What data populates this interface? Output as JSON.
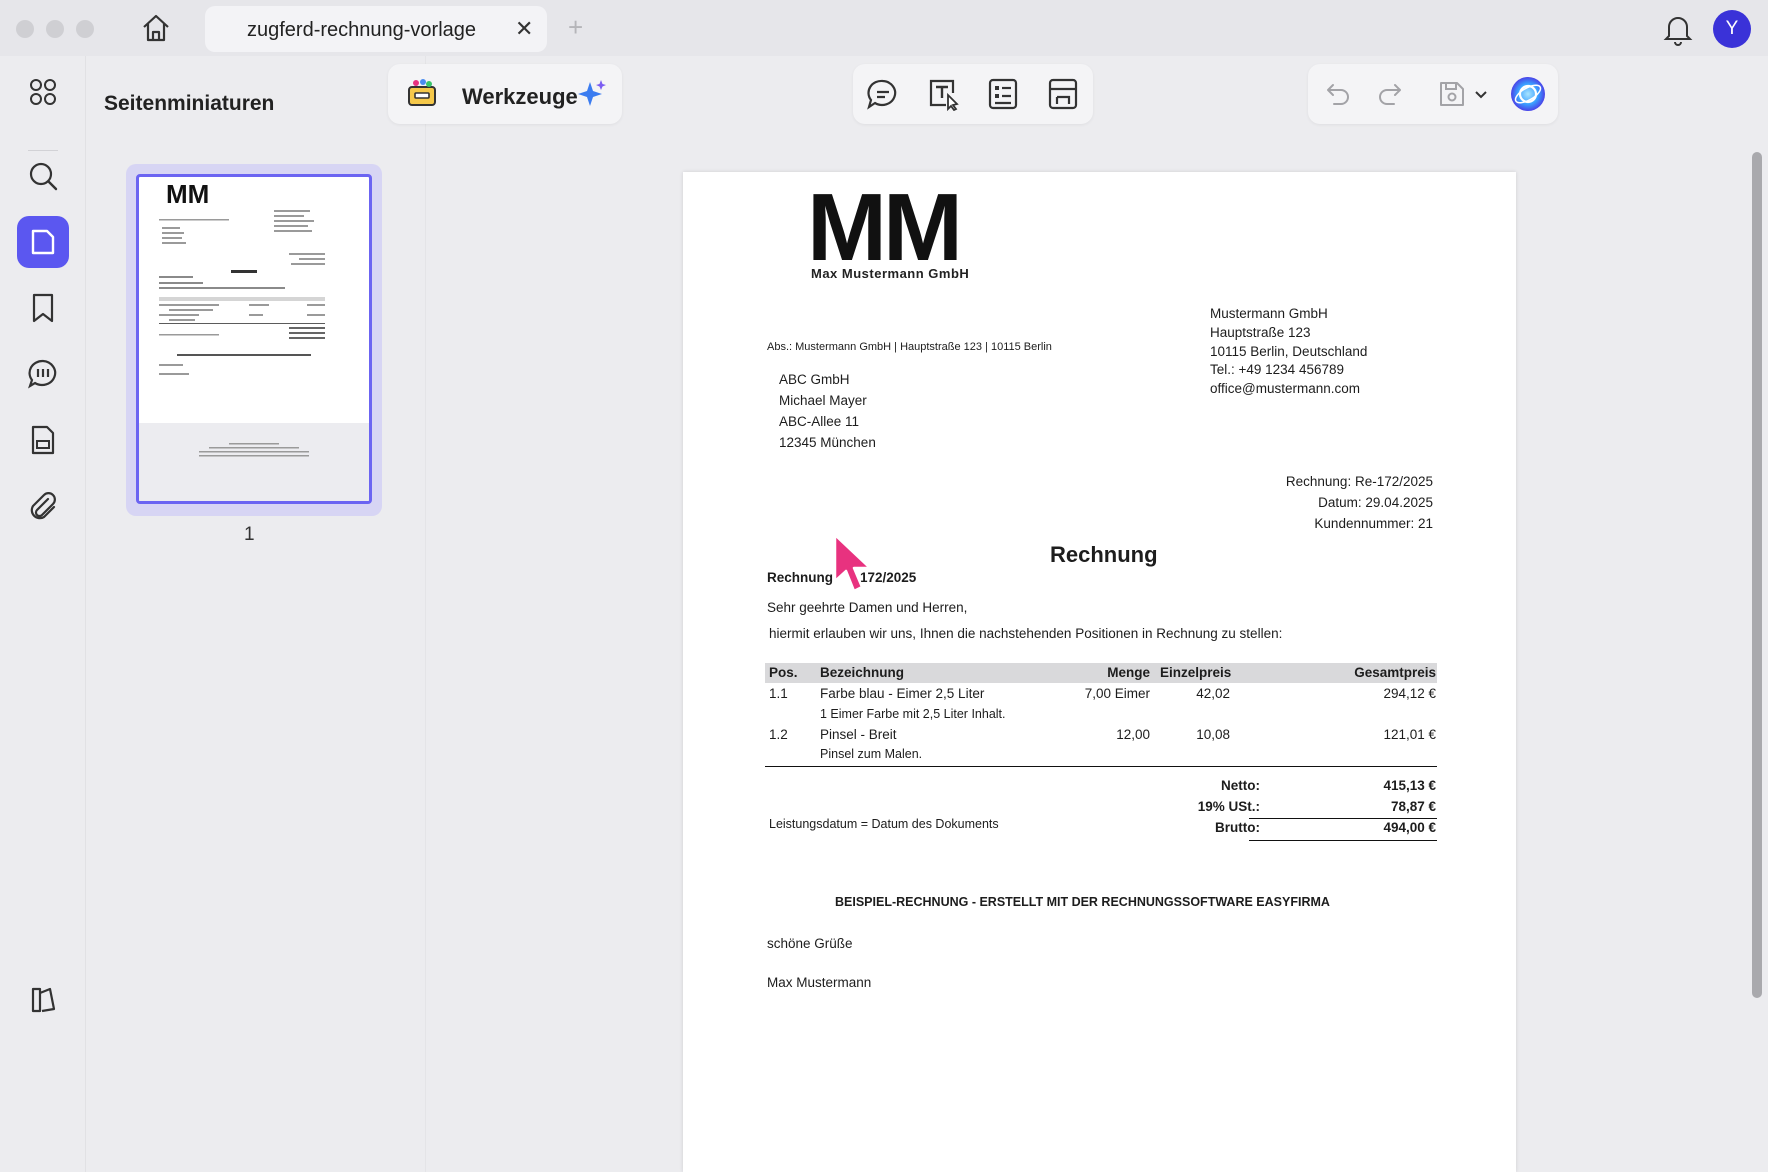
{
  "window": {
    "tab_title": "zugferd-rechnung-vorlage",
    "tab_close": "✕",
    "tab_add": "+",
    "avatar_initial": "Y"
  },
  "sidebar": {
    "panel_title": "Seitenminiaturen",
    "page_number": "1",
    "rail_items": [
      "grid-icon",
      "search-icon",
      "pages-icon",
      "bookmark-icon",
      "comments-icon",
      "forms-icon",
      "attachment-icon",
      "sidebar-toggle-icon"
    ]
  },
  "toolbar": {
    "tools_label": "Werkzeuge",
    "center_icons": [
      "comment-icon",
      "text-edit-icon",
      "form-list-icon",
      "crop-layout-icon"
    ],
    "right_icons": [
      "undo-icon",
      "redo-icon",
      "save-icon",
      "chevron-down-icon",
      "ai-assistant-icon"
    ]
  },
  "document": {
    "logo": {
      "mark": "MM",
      "company": "Max Mustermann GmbH"
    },
    "sender_line": "Abs.: Mustermann GmbH | Hauptstraße 123 | 10115 Berlin",
    "sender_address": [
      "Mustermann GmbH",
      "Hauptstraße 123",
      "10115 Berlin, Deutschland",
      "Tel.: +49 1234 456789",
      "office@mustermann.com"
    ],
    "recipient": [
      "ABC GmbH",
      "Michael Mayer",
      "ABC-Allee 11",
      "12345 München"
    ],
    "meta": [
      "Rechnung: Re-172/2025",
      "Datum: 29.04.2025",
      "Kundennummer: 21"
    ],
    "heading": "Rechnung",
    "subject_left": "Rechnung",
    "subject_right": "172/2025",
    "greeting": "Sehr geehrte Damen und Herren,",
    "intro": "hiermit erlauben wir uns, Ihnen die nachstehenden Positionen in Rechnung zu stellen:",
    "table": {
      "headers": [
        "Pos.",
        "Bezeichnung",
        "Menge",
        "Einzelpreis",
        "Gesamtpreis"
      ],
      "rows": [
        {
          "pos": "1.1",
          "name": "Farbe blau - Eimer 2,5 Liter",
          "desc": "1 Eimer Farbe mit 2,5 Liter Inhalt.",
          "qty": "7,00 Eimer",
          "unit": "42,02",
          "total": "294,12 €"
        },
        {
          "pos": "1.2",
          "name": "Pinsel - Breit",
          "desc": "Pinsel zum Malen.",
          "qty": "12,00",
          "unit": "10,08",
          "total": "121,01 €"
        }
      ]
    },
    "service_date": "Leistungsdatum = Datum des Dokuments",
    "totals": [
      {
        "label": "Netto:",
        "value": "415,13 €"
      },
      {
        "label": "19%  USt.:",
        "value": "78,87 €"
      },
      {
        "label": "Brutto:",
        "value": "494,00 €"
      }
    ],
    "footer_note": "BEISPIEL-RECHNUNG - ERSTELLT MIT DER RECHNUNGSSOFTWARE EASYFIRMA",
    "closing": "schöne Grüße",
    "signature": "Max Mustermann"
  },
  "colors": {
    "accent": "#5b57f0",
    "avatar": "#3a32d8",
    "cursor": "#e8327f"
  }
}
